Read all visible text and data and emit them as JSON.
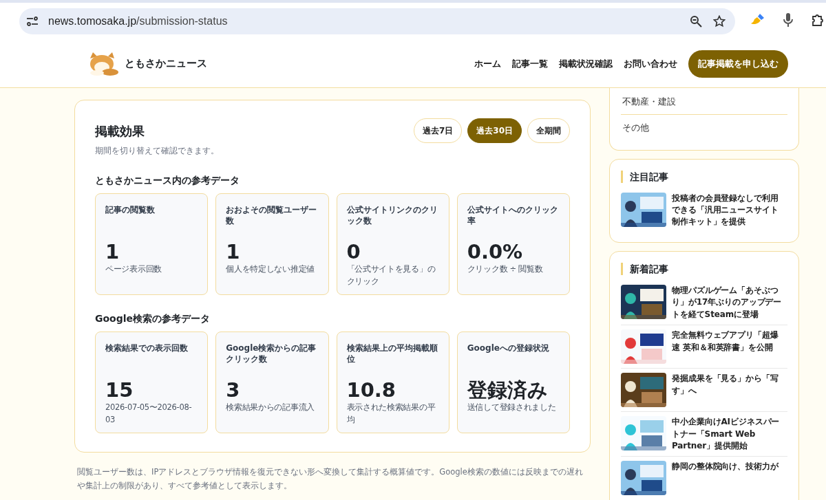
{
  "browser": {
    "url_host": "news.tomosaka.jp",
    "url_path": "/submission-status"
  },
  "header": {
    "logo_text": "ともさかニュース",
    "nav": [
      "ホーム",
      "記事一覧",
      "掲載状況確認",
      "お問い合わせ"
    ],
    "cta": "記事掲載を申し込む"
  },
  "panel": {
    "title": "掲載効果",
    "subtitle": "期間を切り替えて確認できます。",
    "periods": [
      {
        "label": "過去7日",
        "selected": false
      },
      {
        "label": "過去30日",
        "selected": true
      },
      {
        "label": "全期間",
        "selected": false
      }
    ],
    "sections": [
      {
        "heading": "ともさかニュース内の参考データ",
        "metrics": [
          {
            "label": "記事の閲覧数",
            "value": "1",
            "note": "ページ表示回数"
          },
          {
            "label": "おおよその閲覧ユーザー数",
            "value": "1",
            "note": "個人を特定しない推定値"
          },
          {
            "label": "公式サイトリンクのクリック数",
            "value": "0",
            "note": "「公式サイトを見る」のクリック"
          },
          {
            "label": "公式サイトへのクリック率",
            "value": "0.0%",
            "note": "クリック数 ÷ 閲覧数"
          }
        ]
      },
      {
        "heading": "Google検索の参考データ",
        "metrics": [
          {
            "label": "検索結果での表示回数",
            "value": "15",
            "note": "2026-07-05〜2026-08-03"
          },
          {
            "label": "Google検索からの記事クリック数",
            "value": "3",
            "note": "検索結果からの記事流入"
          },
          {
            "label": "検索結果上の平均掲載順位",
            "value": "10.8",
            "note": "表示された検索結果の平均"
          },
          {
            "label": "Googleへの登録状況",
            "value": "登録済み",
            "note": "送信して登録されました"
          }
        ]
      }
    ]
  },
  "footnote": "閲覧ユーザー数は、IPアドレスとブラウザ情報を復元できない形へ変換して集計する概算値です。Google検索の数値には反映までの遅れや集計上の制限があり、すべて参考値として表示します。",
  "sidebar": {
    "categories": [
      "不動産・建設",
      "その他"
    ],
    "featured": {
      "heading": "注目記事",
      "articles": [
        {
          "title": "投稿者の会員登録なしで利用できる「汎用ニュースサイト制作キット」を提供"
        }
      ]
    },
    "latest": {
      "heading": "新着記事",
      "articles": [
        {
          "title": "物理パズルゲーム「あそぶつり」が17年ぶりのアップデートを経てSteamに登場"
        },
        {
          "title": "完全無料ウェブアプリ「超爆速 英和＆和英辞書」を公開"
        },
        {
          "title": "発掘成果を「見る」から「写す」へ"
        },
        {
          "title": "中小企業向けAIビジネスパートナー「Smart Web Partner」提供開始"
        },
        {
          "title": "静岡の整体院向け、技術力が"
        }
      ]
    }
  }
}
